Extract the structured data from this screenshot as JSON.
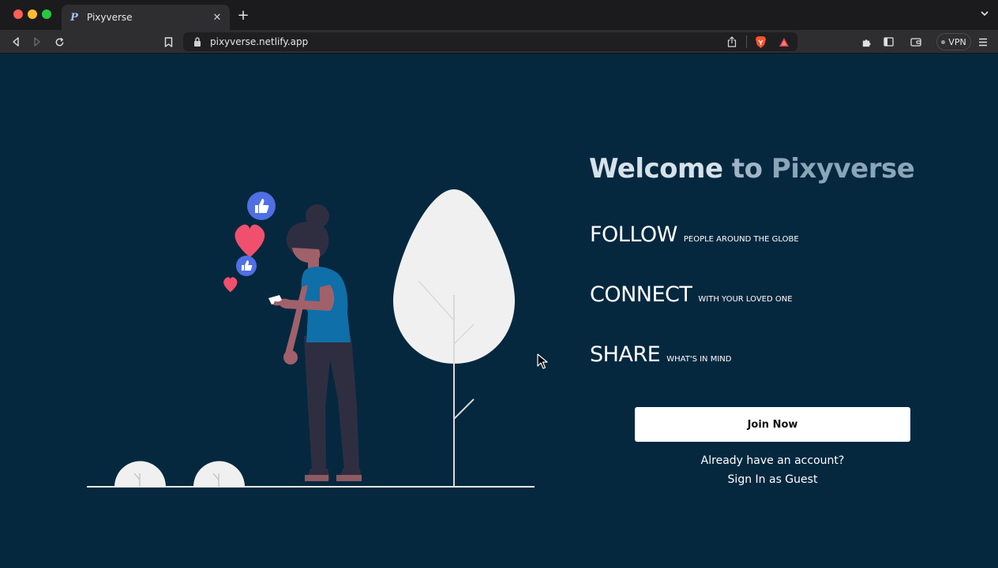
{
  "browser": {
    "tab": {
      "favicon": "P",
      "title": "Pixyverse",
      "close": "✕"
    },
    "new_tab": "+",
    "address": {
      "url": "pixyverse.netlify.app"
    },
    "vpn_label": "VPN"
  },
  "page": {
    "welcome": {
      "part1": "Welcome",
      "part2": "to",
      "part3": "Pixyverse"
    },
    "features": [
      {
        "title": "FOLLOW",
        "subtitle": "PEOPLE AROUND THE GLOBE"
      },
      {
        "title": "CONNECT",
        "subtitle": "WITH YOUR LOVED ONE"
      },
      {
        "title": "SHARE",
        "subtitle": "WHAT'S IN MIND"
      }
    ],
    "join_button": "Join Now",
    "account_prompt": "Already have an account?",
    "guest_link": "Sign In as Guest"
  },
  "colors": {
    "background": "#05283f",
    "heart": "#f0506e",
    "like": "#4f6fe3",
    "shirt": "#0f6fa8"
  },
  "icons": [
    "back-icon",
    "forward-icon",
    "reload-icon",
    "bookmark-icon",
    "lock-icon",
    "share-icon",
    "brave-shields-icon",
    "brave-rewards-icon",
    "extensions-icon",
    "sidebar-icon",
    "wallet-icon",
    "menu-icon"
  ]
}
